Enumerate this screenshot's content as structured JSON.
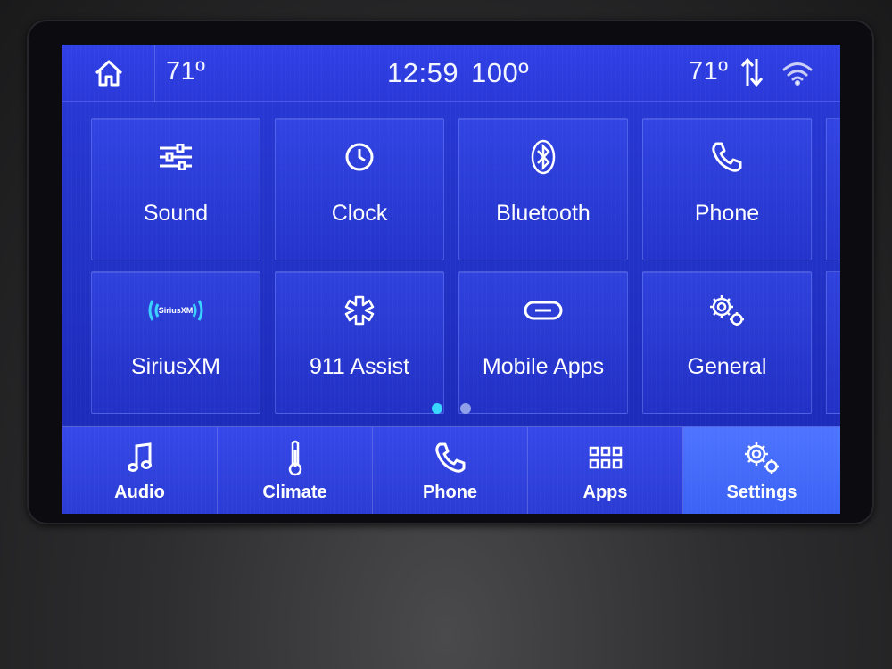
{
  "status_bar": {
    "left_temp": "71º",
    "time": "12:59",
    "outside_temp": "100º",
    "right_temp": "71º",
    "icons": [
      "home-icon",
      "sync-arrows-icon",
      "wifi-icon"
    ]
  },
  "tiles": [
    {
      "label": "Sound",
      "icon": "equalizer-icon"
    },
    {
      "label": "Clock",
      "icon": "clock-icon"
    },
    {
      "label": "Bluetooth",
      "icon": "bluetooth-icon"
    },
    {
      "label": "Phone",
      "icon": "phone-icon"
    },
    {
      "label": "SiriusXM",
      "icon": "siriusxm-logo",
      "logo_text": "SiriusXM"
    },
    {
      "label": "911 Assist",
      "icon": "star-of-life-icon"
    },
    {
      "label": "Mobile Apps",
      "icon": "link-icon"
    },
    {
      "label": "General",
      "icon": "gears-icon"
    }
  ],
  "pagination": {
    "pages": 2,
    "current": 1
  },
  "nav": [
    {
      "label": "Audio",
      "icon": "music-note-icon"
    },
    {
      "label": "Climate",
      "icon": "thermometer-icon"
    },
    {
      "label": "Phone",
      "icon": "phone-icon"
    },
    {
      "label": "Apps",
      "icon": "grid-icon"
    },
    {
      "label": "Settings",
      "icon": "gears-icon",
      "selected": true
    }
  ],
  "colors": {
    "screen_blue": "#2233c8",
    "active_nav": "#3a62f4",
    "dot_active": "#38d6ff"
  }
}
